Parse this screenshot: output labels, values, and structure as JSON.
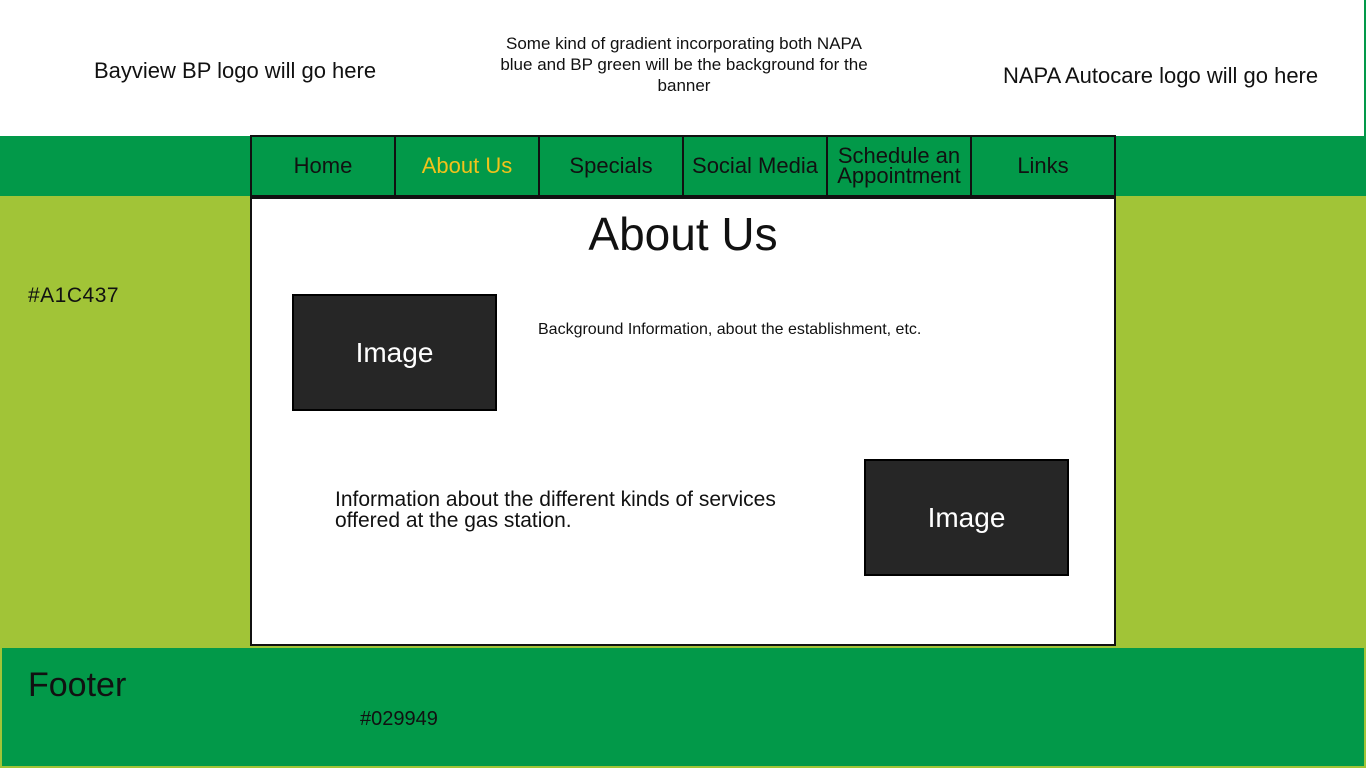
{
  "header": {
    "left_text": "Bayview BP logo will go here",
    "center_text": "Some kind of gradient incorporating both NAPA blue and BP green will be the background for the banner",
    "right_text": "NAPA Autocare logo will go here"
  },
  "nav": {
    "items": [
      {
        "label": "Home"
      },
      {
        "label": "About Us"
      },
      {
        "label": "Specials"
      },
      {
        "label": "Social Media"
      },
      {
        "label": "Schedule an Appointment"
      },
      {
        "label": "Links"
      }
    ],
    "active_color": "#F2C21B"
  },
  "sidebar": {
    "color_code": "#A1C437"
  },
  "content": {
    "title": "About Us",
    "image1_label": "Image",
    "image2_label": "Image",
    "background_info": "Background Information, about the establishment, etc.",
    "services_info": "Information about the different kinds of services offered at the gas station."
  },
  "footer": {
    "title": "Footer",
    "color_code": "#029949"
  },
  "colors": {
    "nav_green": "#029949",
    "page_green": "#A1C437",
    "image_box": "#262626"
  }
}
